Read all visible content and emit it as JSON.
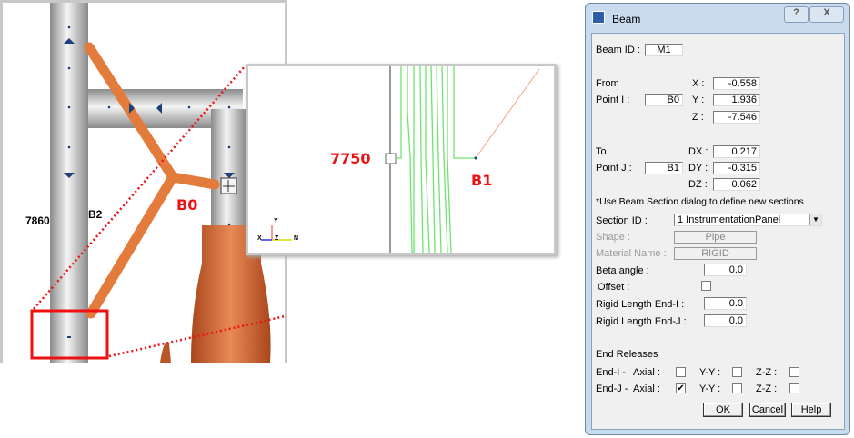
{
  "viewport": {
    "labels": {
      "node_b0": "B0",
      "node_b2": "B2",
      "node_7860": "7860"
    }
  },
  "inset": {
    "labels": {
      "node_7750": "7750",
      "node_b1": "B1"
    },
    "axis": {
      "x": "X",
      "y": "Y",
      "z": "Z",
      "n": "N"
    }
  },
  "dialog": {
    "title": "Beam",
    "help_btn": "?",
    "close_btn": "X",
    "beam_id_label": "Beam ID :",
    "beam_id": "M1",
    "from_label": "From",
    "point_i_label": "Point I :",
    "point_i": "B0",
    "x_label": "X :",
    "x": "-0.558",
    "y_label": "Y :",
    "y": "1.936",
    "z_label": "Z :",
    "z": "-7.546",
    "to_label": "To",
    "point_j_label": "Point J :",
    "point_j": "B1",
    "dx_label": "DX :",
    "dx": "0.217",
    "dy_label": "DY :",
    "dy": "-0.315",
    "dz_label": "DZ :",
    "dz": "0.062",
    "note": "*Use Beam Section dialog to define new sections",
    "section_id_label": "Section ID    :",
    "section_id": "1    InstrumentationPanel",
    "shape_label": "Shape          :",
    "shape": "Pipe",
    "material_label": "Material Name :",
    "material": "RIGID",
    "beta_label": "Beta angle          :",
    "beta": "0.0",
    "offset_label": "Offset               :",
    "offset_checked": false,
    "rigid_i_label": "Rigid Length End-I  :",
    "rigid_i": "0.0",
    "rigid_j_label": "Rigid Length End-J  :",
    "rigid_j": "0.0",
    "end_releases_label": "End Releases",
    "end_i_label": "End-I -",
    "end_j_label": "End-J -",
    "axial_label": "Axial :",
    "yy_label": "Y-Y :",
    "zz_label": "Z-Z :",
    "end_i": {
      "axial": false,
      "yy": false,
      "zz": false
    },
    "end_j": {
      "axial": true,
      "yy": false,
      "zz": false
    },
    "ok": "OK",
    "cancel": "Cancel",
    "help": "Help"
  }
}
